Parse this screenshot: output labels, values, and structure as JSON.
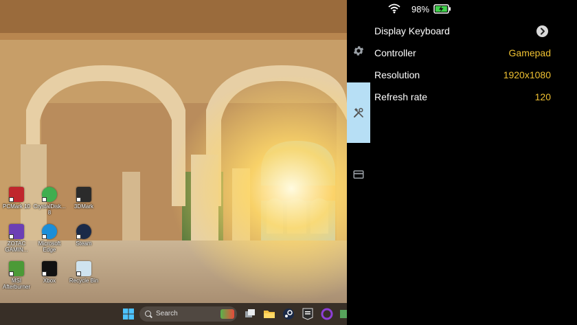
{
  "status_bar": {
    "battery_percent_text": "98%",
    "battery_level": 0.98,
    "wifi_icon": "wifi-icon",
    "battery_icon": "battery-charging-icon"
  },
  "sidebar": {
    "items": [
      {
        "icon": "gear-icon"
      },
      {
        "icon": "tools-icon",
        "active": true
      },
      {
        "icon": "card-icon"
      }
    ]
  },
  "settings": {
    "rows": [
      {
        "label": "Display Keyboard",
        "value": "",
        "icon": "chevron-right-icon"
      },
      {
        "label": "Controller",
        "value": "Gamepad"
      },
      {
        "label": "Resolution",
        "value": "1920x1080"
      },
      {
        "label": "Refresh rate",
        "value": "120"
      }
    ],
    "value_color": "#f1c232",
    "active_tab_color": "#b7dff5"
  },
  "desktop": {
    "icons": [
      {
        "label": "PCMark 10"
      },
      {
        "label": "CrystalDisk... 8"
      },
      {
        "label": "3DMark"
      },
      {
        "label": "ZOTAC GAMIN..."
      },
      {
        "label": "Microsoft Edge"
      },
      {
        "label": "Steam"
      },
      {
        "label": "MSI Afterburner"
      },
      {
        "label": "Xbox"
      },
      {
        "label": "Recycle Bin"
      }
    ]
  },
  "taskbar": {
    "search_placeholder": "Search",
    "apps": [
      "start-icon",
      "maps-icon",
      "task-view-icon",
      "file-explorer-icon",
      "steam-icon",
      "epic-games-icon",
      "app-icon"
    ]
  }
}
